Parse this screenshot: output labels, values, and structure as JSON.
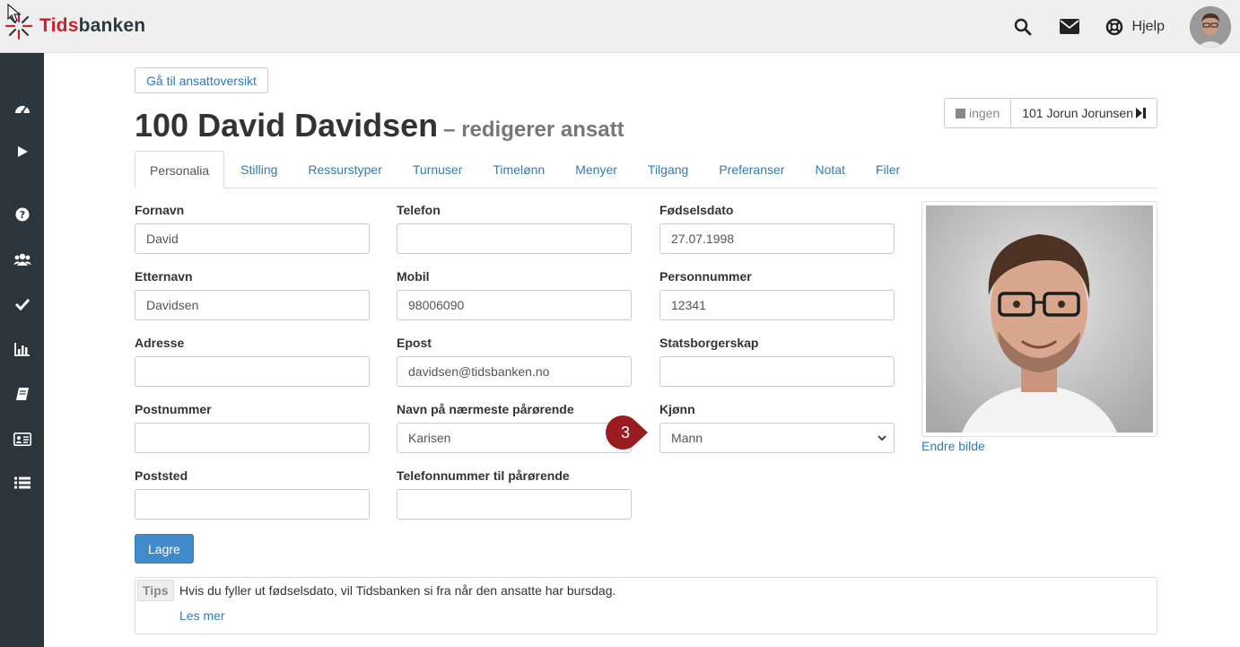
{
  "header": {
    "logo_text_a": "Tids",
    "logo_text_b": "banken",
    "help_label": "Hjelp",
    "icons": [
      "search-icon",
      "envelope-icon",
      "lifebuoy-icon"
    ]
  },
  "sidebar": {
    "items": [
      "dashboard-icon",
      "play-icon",
      "question-icon",
      "users-icon",
      "check-icon",
      "bar-chart-icon",
      "book-icon",
      "id-card-icon",
      "list-icon"
    ]
  },
  "page": {
    "back_button": "Gå til ansattoversikt",
    "title": "100 David Davidsen",
    "subtitle": "– redigerer ansatt",
    "prev_employee": "ingen",
    "next_employee": "101 Jorun Jorunsen"
  },
  "tabs": [
    "Personalia",
    "Stilling",
    "Ressurstyper",
    "Turnuser",
    "Timelønn",
    "Menyer",
    "Tilgang",
    "Preferanser",
    "Notat",
    "Filer"
  ],
  "form": {
    "fornavn": {
      "label": "Fornavn",
      "value": "David"
    },
    "etternavn": {
      "label": "Etternavn",
      "value": "Davidsen"
    },
    "adresse": {
      "label": "Adresse",
      "value": ""
    },
    "postnummer": {
      "label": "Postnummer",
      "value": ""
    },
    "poststed": {
      "label": "Poststed",
      "value": ""
    },
    "telefon": {
      "label": "Telefon",
      "value": ""
    },
    "mobil": {
      "label": "Mobil",
      "value": "98006090"
    },
    "epost": {
      "label": "Epost",
      "value": "davidsen@tidsbanken.no"
    },
    "parorende": {
      "label": "Navn på nærmeste pårørende",
      "value": "Karisen"
    },
    "parorende_tlf": {
      "label": "Telefonnummer til pårørende",
      "value": ""
    },
    "fodselsdato": {
      "label": "Fødselsdato",
      "value": "27.07.1998"
    },
    "personnummer": {
      "label": "Personnummer",
      "value": "12341"
    },
    "statsborgerskap": {
      "label": "Statsborgerskap",
      "value": ""
    },
    "kjonn": {
      "label": "Kjønn",
      "value": "Mann"
    },
    "save_label": "Lagre"
  },
  "photo": {
    "change_link": "Endre bilde"
  },
  "callout": {
    "number": "3",
    "color": "#9b1c20"
  },
  "tips": {
    "label": "Tips",
    "text": "Hvis du fyller ut fødselsdato, vil Tidsbanken si fra når den ansatte har bursdag.",
    "link": "Les mer"
  },
  "colors": {
    "link": "#337ab7",
    "primary": "#428bca",
    "sidebar": "#2a353c",
    "brand_red": "#c8232c"
  }
}
